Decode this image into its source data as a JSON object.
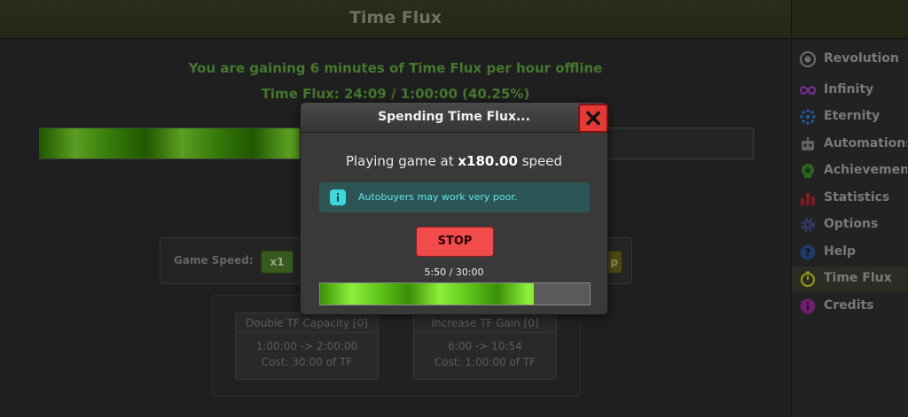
{
  "header": {
    "title": "Time Flux"
  },
  "main": {
    "gain_text": "You are gaining 6 minutes of Time Flux per hour offline",
    "flux_text": "Time Flux: 24:09 / 1:00:00 (40.25%)",
    "flux_progress_percent": 40.25,
    "game_speed_label": "Game Speed:",
    "speed_button_x1": "x1",
    "speed_button_partial": "p",
    "upgrades": [
      {
        "title": "Double TF Capacity [0]",
        "line1": "1:00:00 -> 2:00:00",
        "line2": "Cost: 30:00 of TF"
      },
      {
        "title": "Increase TF Gain [0]",
        "line1": "6:00 -> 10:54",
        "line2": "Cost: 1:00:00 of TF"
      }
    ]
  },
  "sidebar": {
    "items": [
      {
        "label": "Revolution",
        "icon": "circle-target-icon"
      },
      {
        "label": "Infinity",
        "icon": "infinity-icon"
      },
      {
        "label": "Eternity",
        "icon": "dots-ring-icon"
      },
      {
        "label": "Automations",
        "icon": "robot-icon"
      },
      {
        "label": "Achievements",
        "icon": "award-icon"
      },
      {
        "label": "Statistics",
        "icon": "bar-chart-icon"
      },
      {
        "label": "Options",
        "icon": "gear-icon"
      },
      {
        "label": "Help",
        "icon": "question-icon"
      },
      {
        "label": "Time Flux",
        "icon": "stopwatch-icon",
        "active": true
      },
      {
        "label": "Credits",
        "icon": "info-icon"
      }
    ]
  },
  "modal": {
    "title": "Spending Time Flux...",
    "speed_prefix": "Playing game at ",
    "speed_value": "x180.00",
    "speed_suffix": " speed",
    "info_text": "Autobuyers may work very poor.",
    "stop_label": "STOP",
    "progress_text": "5:50 / 30:00",
    "progress_fraction": 0.7944
  },
  "colors": {
    "accent_green": "#5fa640",
    "stop_red": "#f24b4b",
    "info_cyan": "#5fe5e5"
  }
}
